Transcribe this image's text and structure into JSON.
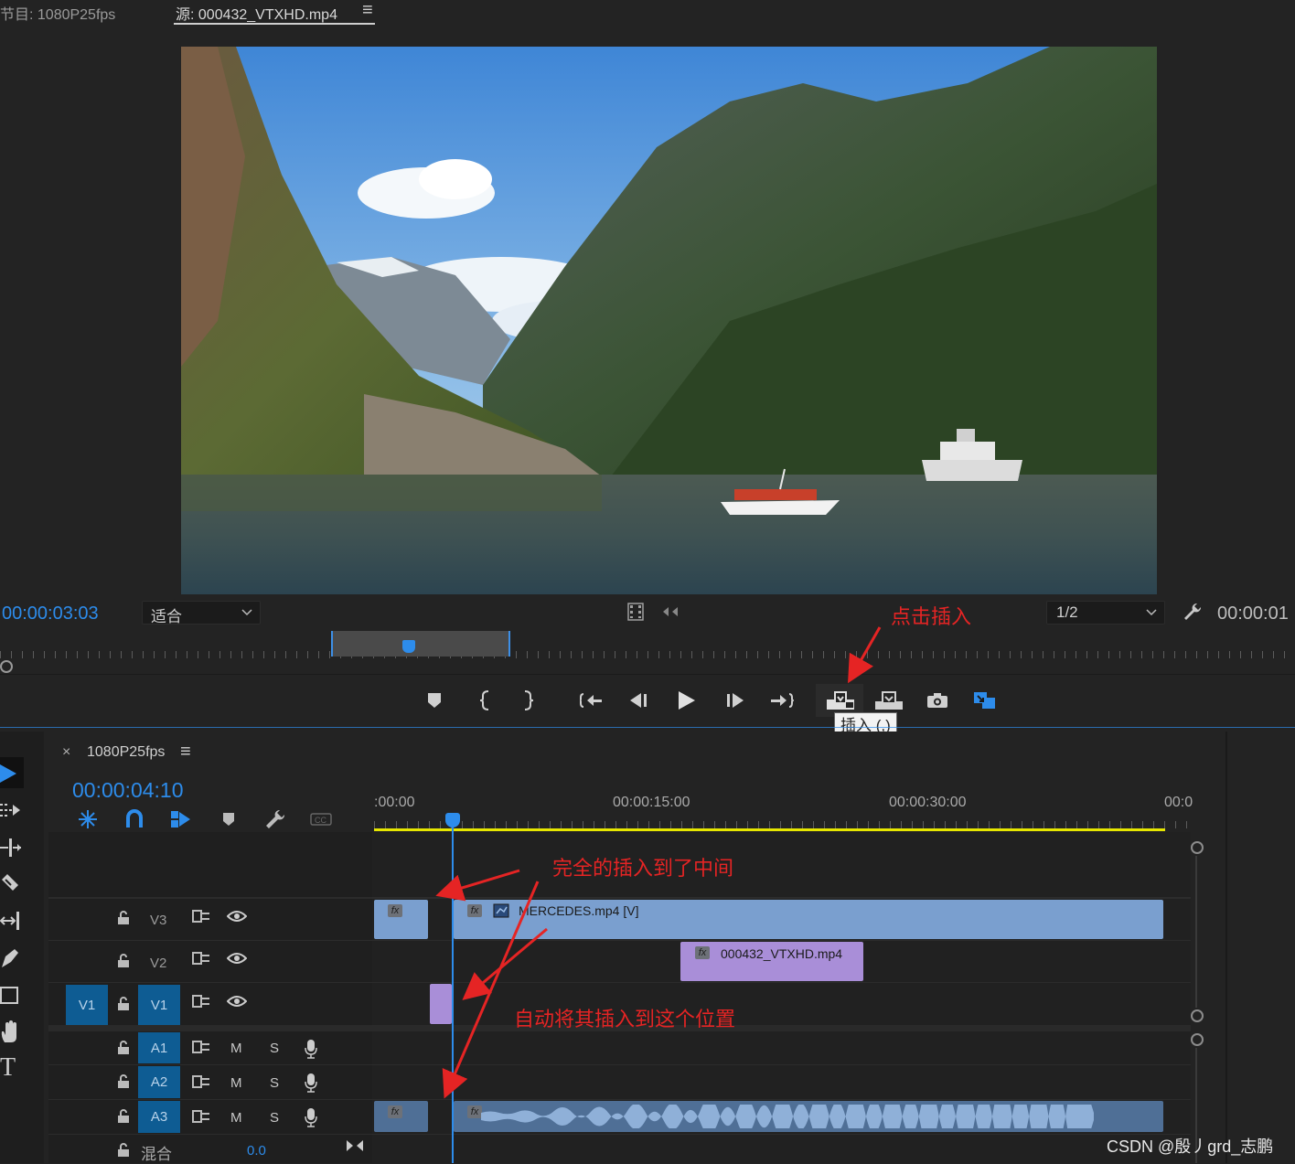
{
  "source_monitor": {
    "tab_program": "节目: 1080P25fps",
    "tab_source": "源: 000432_VTXHD.mp4",
    "menu_glyph": "≡",
    "timecode_current": "00:00:03:03",
    "fit_label": "适合",
    "resolution_label": "1/2",
    "timecode_duration": "00:00:01"
  },
  "transport": {
    "buttons": [
      "add-marker",
      "mark-in",
      "mark-out",
      "go-to-in",
      "step-back",
      "play",
      "step-forward",
      "go-to-out",
      "insert",
      "overwrite",
      "export-frame",
      "button-editor"
    ],
    "tooltip": "插入 (,)"
  },
  "timeline": {
    "close_glyph": "×",
    "sequence_name": "1080P25fps",
    "menu_glyph": "≡",
    "timecode": "00:00:04:10",
    "ruler": [
      ":00:00",
      "00:00:15:00",
      "00:00:30:00",
      "00:0"
    ],
    "tracks": {
      "v3": "V3",
      "v2": "V2",
      "v1_src": "V1",
      "v1": "V1",
      "a1": "A1",
      "a2": "A2",
      "a3": "A3",
      "m": "M",
      "s": "S",
      "mix_label": "混合",
      "mix_value": "0.0"
    },
    "clips": {
      "fx": "fx",
      "v3_main": "MERCEDES.mp4 [V]",
      "v2_clip": "000432_VTXHD.mp4"
    }
  },
  "annotations": {
    "click_insert": "点击插入",
    "fully_inserted": "完全的插入到了中间",
    "auto_insert": "自动将其插入到这个位置"
  },
  "watermark": "CSDN @殷丿grd_志鹏",
  "colors": {
    "accent_blue": "#2d8ceb",
    "video_clip": "#7a9fcf",
    "purple_clip": "#a98ed8",
    "annotation_red": "#e52424",
    "work_area_yellow": "#e6e600"
  }
}
